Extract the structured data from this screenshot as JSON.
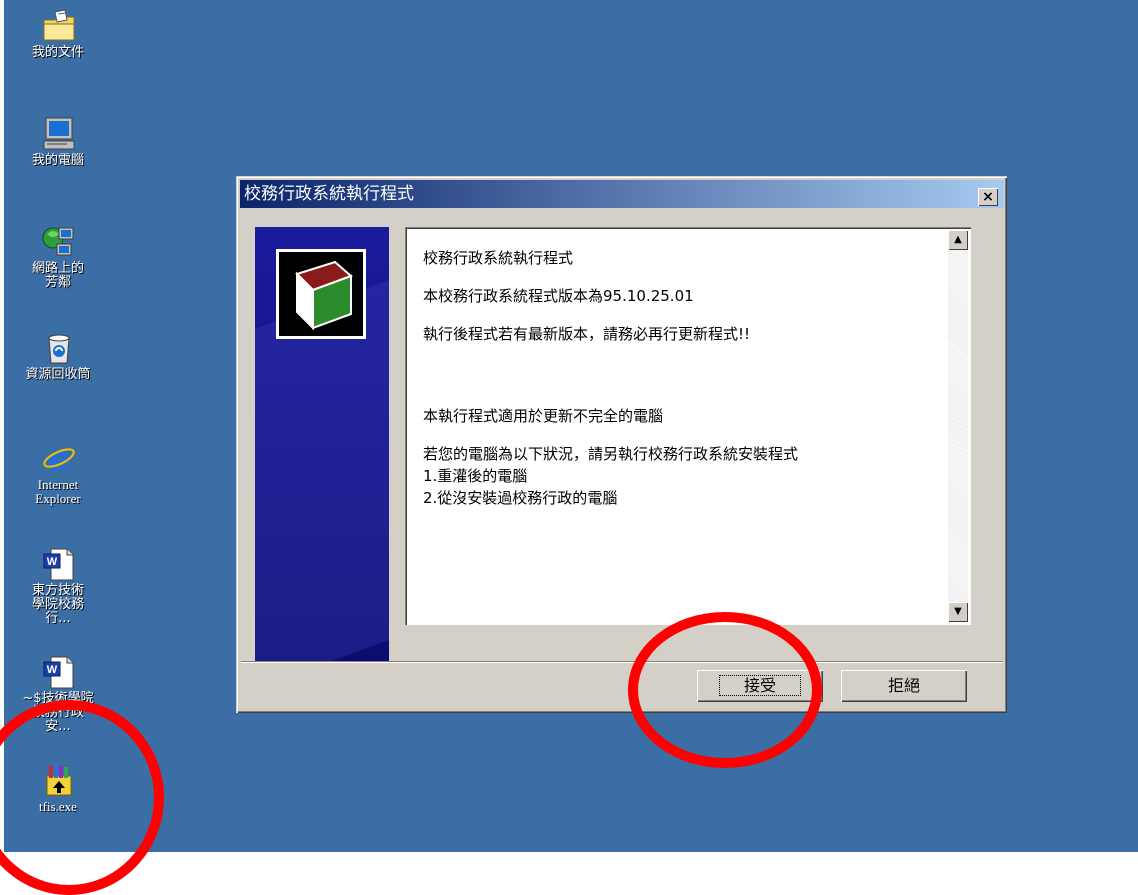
{
  "desktop": {
    "icons": [
      {
        "label": "我的文件",
        "icon": "my-documents-folder-icon"
      },
      {
        "label": "我的電腦",
        "icon": "my-computer-icon"
      },
      {
        "label": "網路上的芳鄰",
        "icon": "network-places-icon"
      },
      {
        "label": "資源回收筒",
        "icon": "recycle-bin-icon"
      },
      {
        "label": "Internet Explorer",
        "icon": "internet-explorer-icon"
      },
      {
        "label": "東方技術學院校務行...",
        "icon": "word-document-icon"
      },
      {
        "label": "~$技術學院校務行政安...",
        "icon": "word-document-icon"
      },
      {
        "label": "tfis.exe",
        "icon": "installer-package-icon"
      }
    ]
  },
  "dialog": {
    "title": "校務行政系統執行程式",
    "close_label": "×",
    "body": {
      "line1": "校務行政系統執行程式",
      "line2": "本校務行政系統程式版本為95.10.25.01",
      "line3": "執行後程式若有最新版本，請務必再行更新程式!!",
      "line4": "本執行程式適用於更新不完全的電腦",
      "line5": "若您的電腦為以下狀況，請另執行校務行政系統安裝程式",
      "line6": "1.重灌後的電腦",
      "line7": "2.從沒安裝過校務行政的電腦"
    },
    "accept_label": "接受",
    "reject_label": "拒絕"
  },
  "colors": {
    "desktop": "#3a6ea5",
    "titlebar_start": "#0a246a",
    "annotation": "#ff0000"
  }
}
